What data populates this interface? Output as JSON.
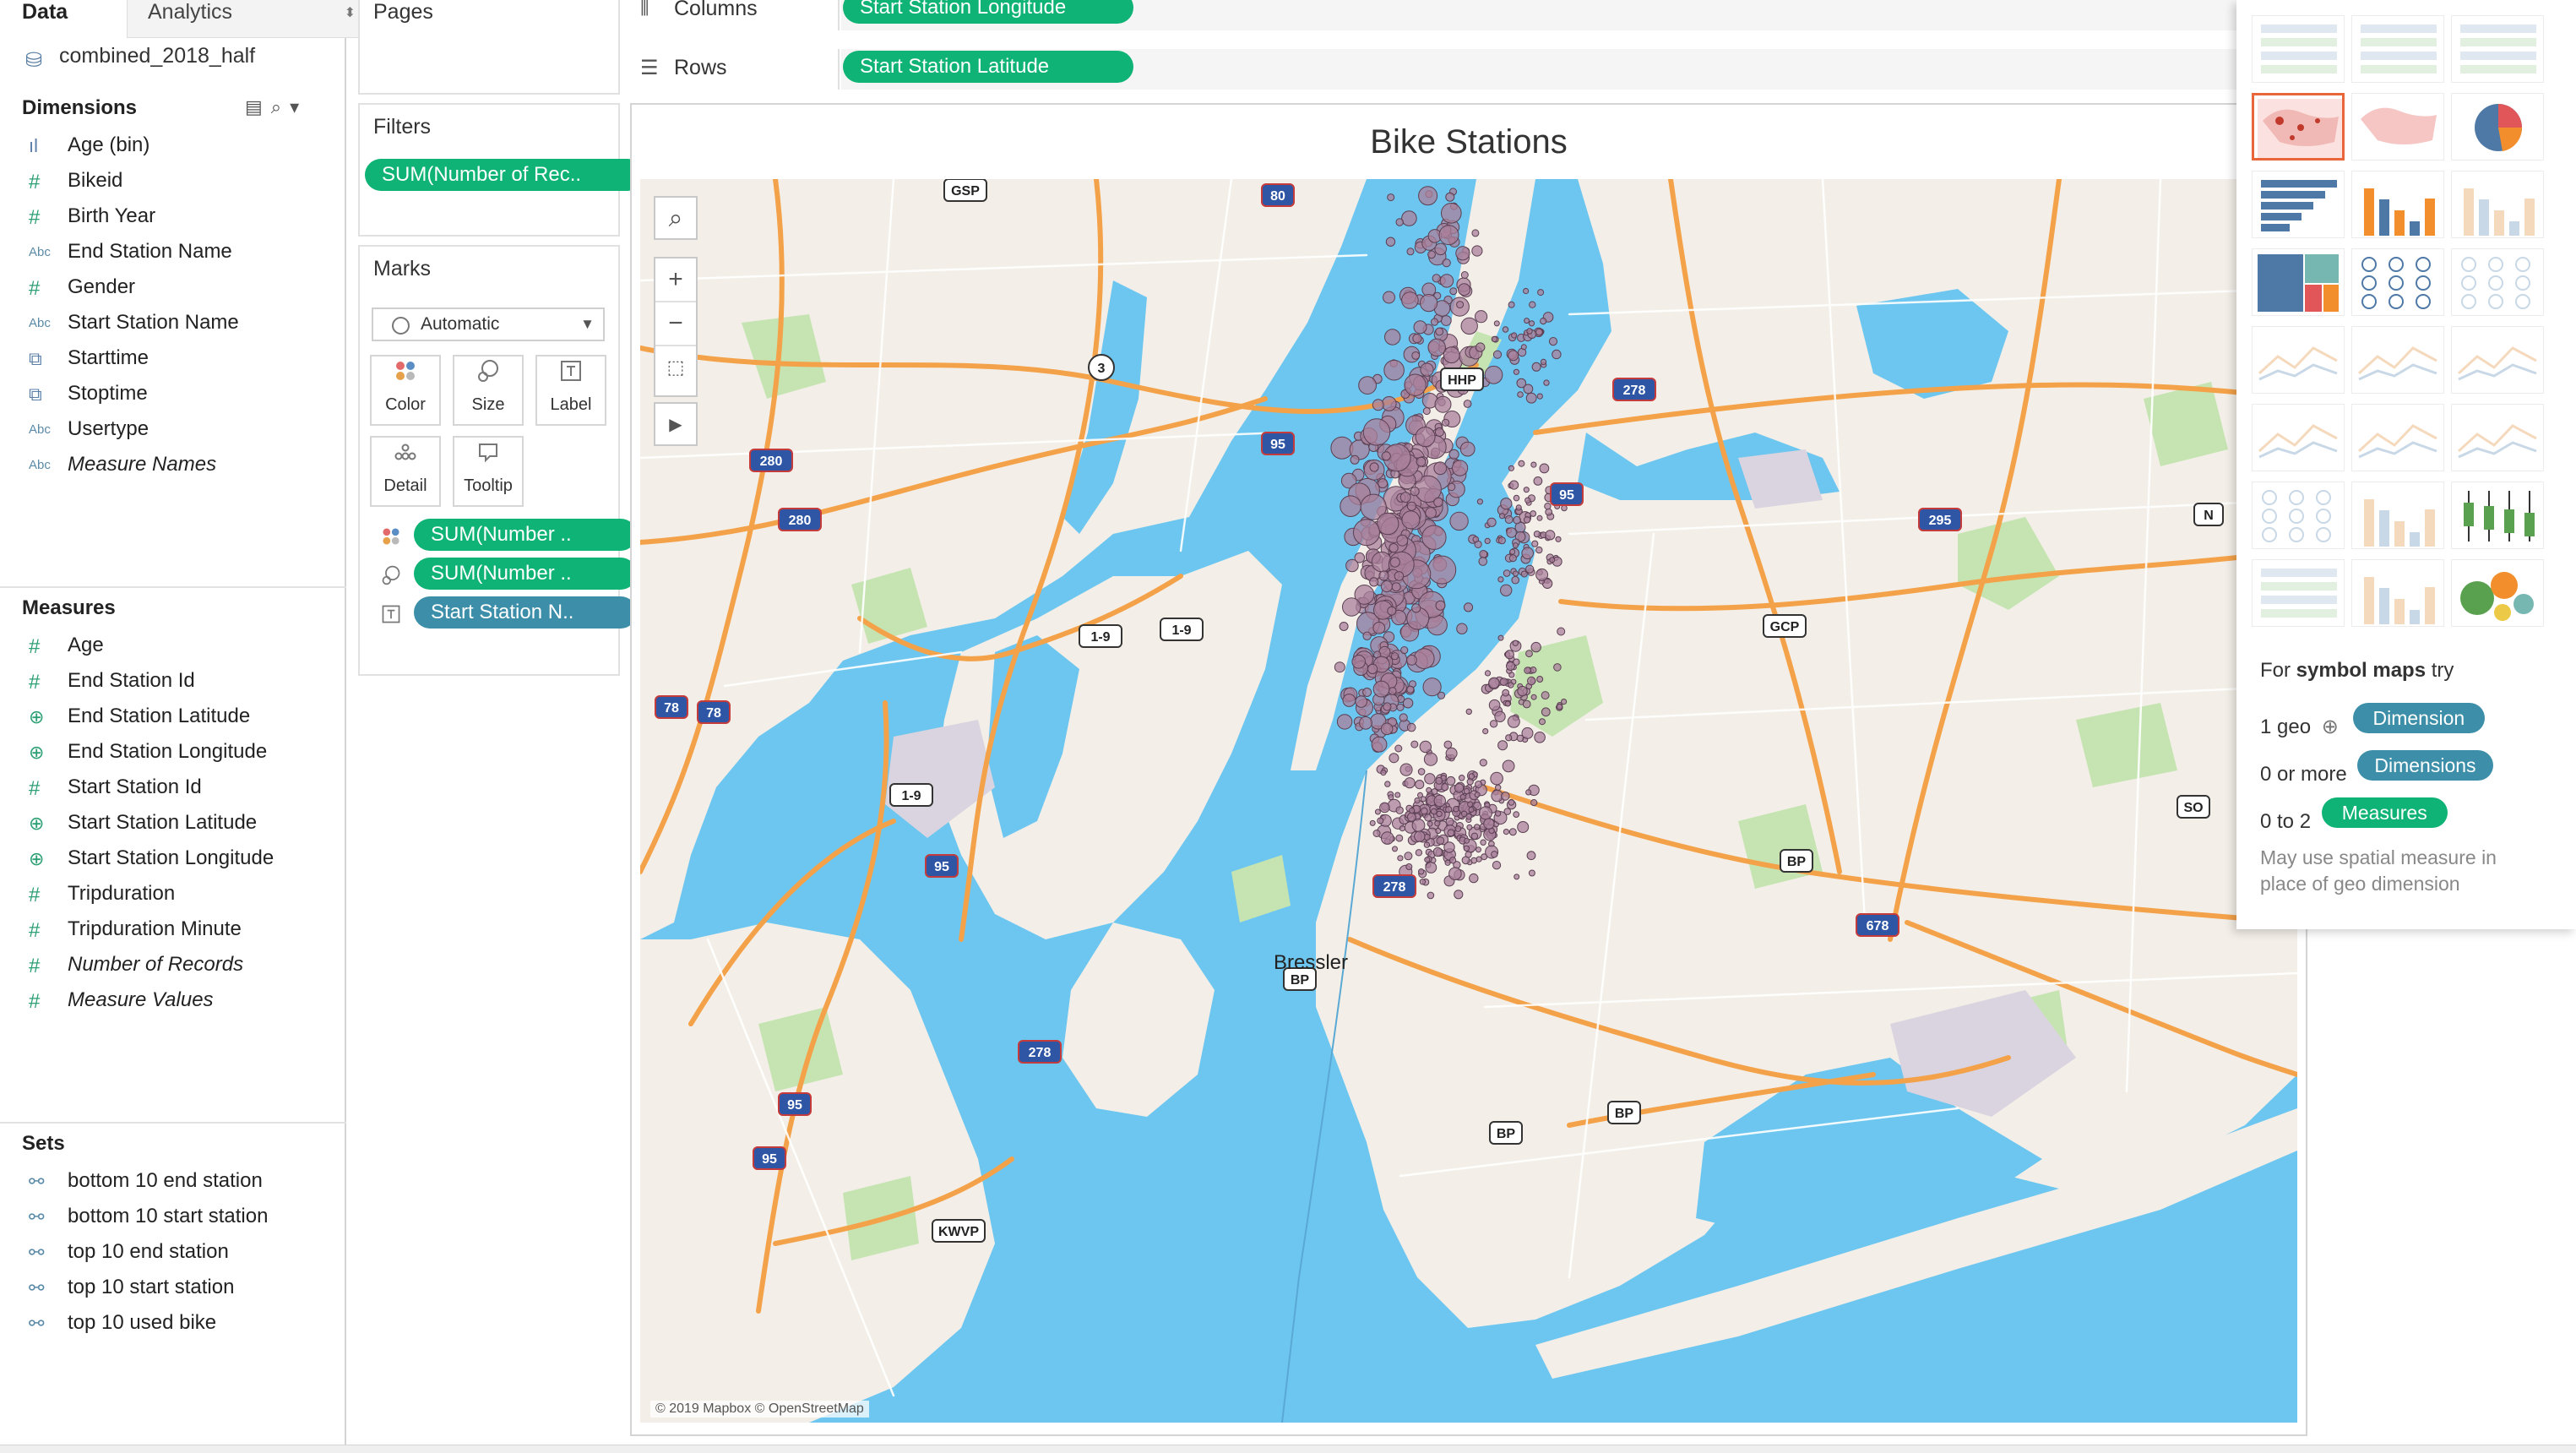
{
  "tabs": {
    "data": "Data",
    "analytics": "Analytics"
  },
  "datasource": "combined_2018_half",
  "dimensions": {
    "title": "Dimensions",
    "items": [
      {
        "icon": "bin",
        "label": "Age (bin)"
      },
      {
        "icon": "num",
        "label": "Bikeid"
      },
      {
        "icon": "num",
        "label": "Birth Year"
      },
      {
        "icon": "abc",
        "label": "End Station Name"
      },
      {
        "icon": "num",
        "label": "Gender"
      },
      {
        "icon": "abc",
        "label": "Start Station Name"
      },
      {
        "icon": "date",
        "label": "Starttime"
      },
      {
        "icon": "date",
        "label": "Stoptime"
      },
      {
        "icon": "abc",
        "label": "Usertype"
      },
      {
        "icon": "abc",
        "label": "Measure Names",
        "italic": true
      }
    ]
  },
  "measures": {
    "title": "Measures",
    "items": [
      {
        "icon": "num",
        "label": "Age"
      },
      {
        "icon": "num",
        "label": "End Station Id"
      },
      {
        "icon": "geo",
        "label": "End Station Latitude"
      },
      {
        "icon": "geo",
        "label": "End Station Longitude"
      },
      {
        "icon": "num",
        "label": "Start Station Id"
      },
      {
        "icon": "geo",
        "label": "Start Station Latitude"
      },
      {
        "icon": "geo",
        "label": "Start Station Longitude"
      },
      {
        "icon": "num",
        "label": "Tripduration"
      },
      {
        "icon": "num",
        "label": "Tripduration Minute"
      },
      {
        "icon": "num",
        "label": "Number of Records",
        "italic": true
      },
      {
        "icon": "num",
        "label": "Measure Values",
        "italic": true
      }
    ]
  },
  "sets": {
    "title": "Sets",
    "items": [
      {
        "label": "bottom 10 end station"
      },
      {
        "label": "bottom 10 start station"
      },
      {
        "label": "top 10 end station"
      },
      {
        "label": "top 10 start station"
      },
      {
        "label": "top 10 used bike"
      }
    ]
  },
  "pages": {
    "title": "Pages"
  },
  "filters": {
    "title": "Filters",
    "pill": "SUM(Number of Rec.."
  },
  "marks": {
    "title": "Marks",
    "type": "Automatic",
    "buttons": {
      "color": "Color",
      "size": "Size",
      "label": "Label",
      "detail": "Detail",
      "tooltip": "Tooltip"
    },
    "pills": [
      "SUM(Number ..",
      "SUM(Number ..",
      "Start Station N.."
    ]
  },
  "columns": {
    "label": "Columns",
    "pill": "Start Station Longitude"
  },
  "rows": {
    "label": "Rows",
    "pill": "Start Station Latitude"
  },
  "viz": {
    "title": "Bike Stations",
    "attribution": "© 2019 Mapbox © OpenStreetMap",
    "place_label": "Bressler",
    "shields": [
      "GSP",
      "80",
      "3",
      "280",
      "280",
      "95",
      "HHP",
      "278",
      "95",
      "295",
      "N",
      "1-9",
      "1-9",
      "GCP",
      "78",
      "78",
      "1-9",
      "95",
      "278",
      "SO",
      "BP",
      "678",
      "BP",
      "278",
      "95",
      "95",
      "BP",
      "BP",
      "KWVP"
    ]
  },
  "showme": {
    "hint_prefix": "For ",
    "hint_bold": "symbol maps",
    "hint_suffix": " try",
    "req1_text": "1 geo",
    "req1_pill": "Dimension",
    "req2_text": "0 or more",
    "req2_pill": "Dimensions",
    "req3_text": "0 to 2",
    "req3_pill": "Measures",
    "note": "May use spatial measure in place of geo dimension"
  },
  "colors": {
    "green_pill": "#0fb375",
    "blue_pill": "#3c8ea9",
    "water": "#6dc6ef",
    "land": "#f3efe8",
    "marks": "#a9809b",
    "selected_chart": "#e8663a"
  }
}
